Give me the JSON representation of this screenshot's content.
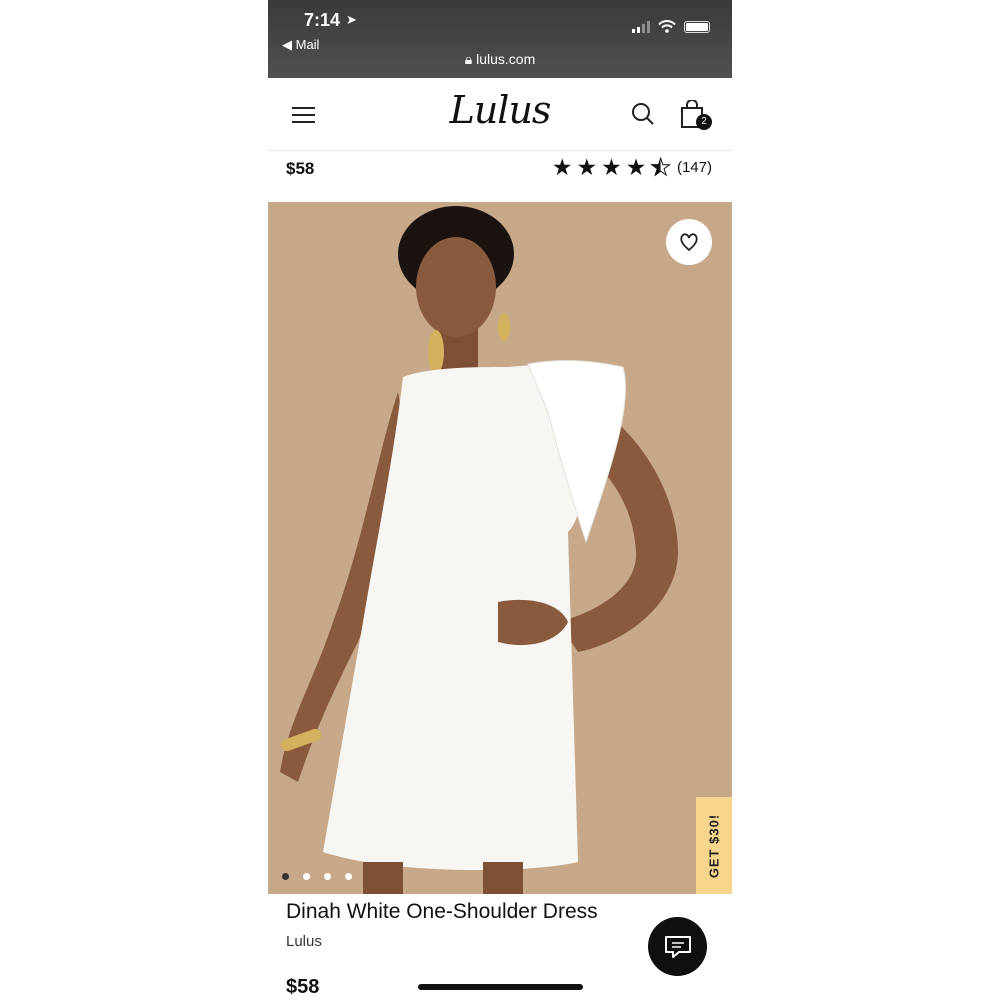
{
  "status_bar": {
    "time": "7:14",
    "location_arrow": "location-arrow-icon",
    "back_label": "◀ Mail",
    "url": "lulus.com"
  },
  "header": {
    "logo": "Lulus",
    "cart_count": "2"
  },
  "product": {
    "price_top": "$58",
    "rating": 4.5,
    "review_count": "(147)",
    "image_count": 4,
    "active_image": 1,
    "promo_tab": "GET $30!",
    "name": "Dinah White One-Shoulder Dress",
    "brand": "Lulus",
    "price": "$58"
  },
  "colors": {
    "status_bar": "#454545",
    "image_background": "#c7a98a",
    "promo_tab": "#f5d68c",
    "chat_button": "#0f0f0f"
  }
}
